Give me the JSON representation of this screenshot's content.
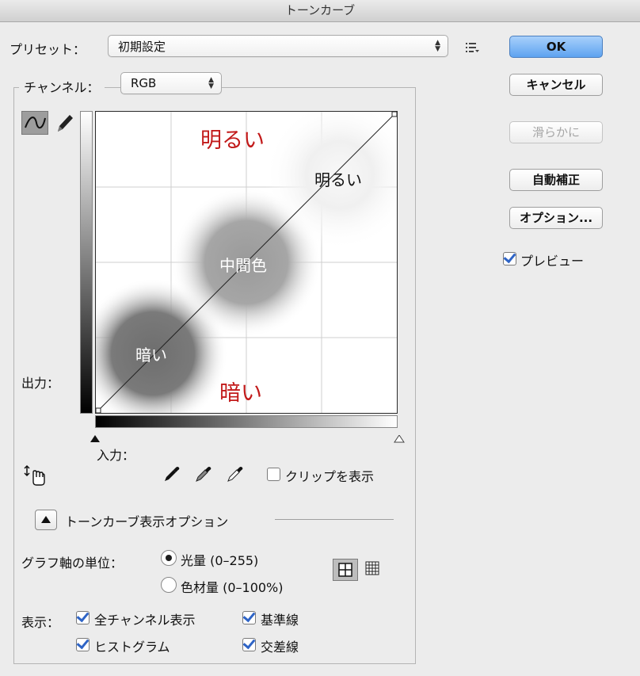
{
  "window": {
    "title": "トーンカーブ"
  },
  "preset": {
    "label": "プリセット：",
    "value": "初期設定"
  },
  "channel": {
    "label": "チャンネル：",
    "value": "RGB"
  },
  "buttons": {
    "ok": "OK",
    "cancel": "キャンセル",
    "smooth": "滑らかに",
    "auto": "自動補正",
    "options": "オプション..."
  },
  "preview": {
    "label": "プレビュー",
    "checked": true
  },
  "axes": {
    "output_label": "出力：",
    "input_label": "入力："
  },
  "annotations": {
    "bright_red": "明るい",
    "dark_red": "暗い",
    "highlights": "明るい",
    "midtones": "中間色",
    "shadows": "暗い"
  },
  "clip": {
    "label": "クリップを表示",
    "checked": false
  },
  "display_options": {
    "title": "トーンカーブ表示オプション"
  },
  "graph_units": {
    "label": "グラフ軸の単位：",
    "options": [
      "光量 (0–255)",
      "色材量 (0–100%)"
    ],
    "selected": 0
  },
  "show": {
    "label": "表示：",
    "items": [
      {
        "label": "全チャンネル表示",
        "checked": true
      },
      {
        "label": "基準線",
        "checked": true
      },
      {
        "label": "ヒストグラム",
        "checked": true
      },
      {
        "label": "交差線",
        "checked": true
      }
    ]
  },
  "colors": {
    "accent": "#2e64c6",
    "annotation_red": "#c21a1a"
  }
}
